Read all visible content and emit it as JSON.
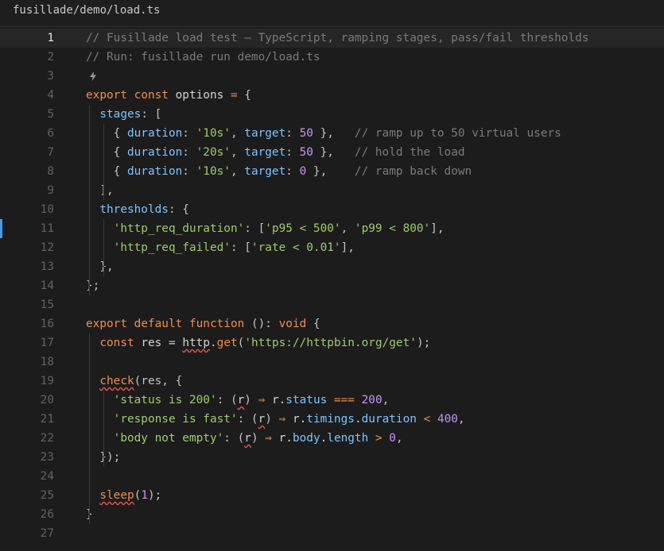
{
  "file_path": "fusillade/demo/load.ts",
  "active_line": 1,
  "modified_line": 11,
  "colors": {
    "background": "#1c1c1c",
    "keyword": "#f28d4d",
    "comment": "#7a7a7a",
    "string": "#9ecb6b",
    "number": "#c594f4",
    "property": "#7cc4ff",
    "modified_marker": "#4a9bd9"
  },
  "icons": [
    "lightbulb-icon"
  ],
  "lines": [
    {
      "n": "1",
      "tokens": [
        {
          "t": "// Fusillade load test — TypeScript, ramping stages, pass/fail thresholds",
          "c": "cm"
        }
      ]
    },
    {
      "n": "2",
      "tokens": [
        {
          "t": "// Run: fusillade run demo/load.ts",
          "c": "cm"
        }
      ]
    },
    {
      "n": "3",
      "tokens": []
    },
    {
      "n": "4",
      "tokens": [
        {
          "t": "export",
          "c": "kw"
        },
        {
          "t": " "
        },
        {
          "t": "const",
          "c": "kw"
        },
        {
          "t": " options "
        },
        {
          "t": "=",
          "c": "op"
        },
        {
          "t": " {",
          "c": "punc"
        }
      ]
    },
    {
      "n": "5",
      "tokens": [
        {
          "t": "  "
        },
        {
          "t": "stages",
          "c": "prop"
        },
        {
          "t": ": [",
          "c": "punc"
        }
      ]
    },
    {
      "n": "6",
      "tokens": [
        {
          "t": "    { ",
          "c": "punc"
        },
        {
          "t": "duration",
          "c": "prop"
        },
        {
          "t": ": ",
          "c": "punc"
        },
        {
          "t": "'10s'",
          "c": "str"
        },
        {
          "t": ", ",
          "c": "punc"
        },
        {
          "t": "target",
          "c": "prop"
        },
        {
          "t": ": ",
          "c": "punc"
        },
        {
          "t": "50",
          "c": "num"
        },
        {
          "t": " },   ",
          "c": "punc"
        },
        {
          "t": "// ramp up to 50 virtual users",
          "c": "cm"
        }
      ]
    },
    {
      "n": "7",
      "tokens": [
        {
          "t": "    { ",
          "c": "punc"
        },
        {
          "t": "duration",
          "c": "prop"
        },
        {
          "t": ": ",
          "c": "punc"
        },
        {
          "t": "'20s'",
          "c": "str"
        },
        {
          "t": ", ",
          "c": "punc"
        },
        {
          "t": "target",
          "c": "prop"
        },
        {
          "t": ": ",
          "c": "punc"
        },
        {
          "t": "50",
          "c": "num"
        },
        {
          "t": " },   ",
          "c": "punc"
        },
        {
          "t": "// hold the load",
          "c": "cm"
        }
      ]
    },
    {
      "n": "8",
      "tokens": [
        {
          "t": "    { ",
          "c": "punc"
        },
        {
          "t": "duration",
          "c": "prop"
        },
        {
          "t": ": ",
          "c": "punc"
        },
        {
          "t": "'10s'",
          "c": "str"
        },
        {
          "t": ", ",
          "c": "punc"
        },
        {
          "t": "target",
          "c": "prop"
        },
        {
          "t": ": ",
          "c": "punc"
        },
        {
          "t": "0",
          "c": "num"
        },
        {
          "t": " },    ",
          "c": "punc"
        },
        {
          "t": "// ramp back down",
          "c": "cm"
        }
      ]
    },
    {
      "n": "9",
      "tokens": [
        {
          "t": "  ],",
          "c": "punc"
        }
      ]
    },
    {
      "n": "10",
      "tokens": [
        {
          "t": "  "
        },
        {
          "t": "thresholds",
          "c": "prop"
        },
        {
          "t": ": {",
          "c": "punc"
        }
      ]
    },
    {
      "n": "11",
      "tokens": [
        {
          "t": "    "
        },
        {
          "t": "'http_req_duration'",
          "c": "str"
        },
        {
          "t": ": [",
          "c": "punc"
        },
        {
          "t": "'p95 < 500'",
          "c": "str"
        },
        {
          "t": ", ",
          "c": "punc"
        },
        {
          "t": "'p99 < 800'",
          "c": "str"
        },
        {
          "t": "],",
          "c": "punc"
        }
      ]
    },
    {
      "n": "12",
      "tokens": [
        {
          "t": "    "
        },
        {
          "t": "'http_req_failed'",
          "c": "str"
        },
        {
          "t": ": [",
          "c": "punc"
        },
        {
          "t": "'rate < 0.01'",
          "c": "str"
        },
        {
          "t": "],",
          "c": "punc"
        }
      ]
    },
    {
      "n": "13",
      "tokens": [
        {
          "t": "  },",
          "c": "punc"
        }
      ]
    },
    {
      "n": "14",
      "tokens": [
        {
          "t": "};",
          "c": "punc"
        }
      ]
    },
    {
      "n": "15",
      "tokens": []
    },
    {
      "n": "16",
      "tokens": [
        {
          "t": "export",
          "c": "kw"
        },
        {
          "t": " "
        },
        {
          "t": "default",
          "c": "kw"
        },
        {
          "t": " "
        },
        {
          "t": "function",
          "c": "kw"
        },
        {
          "t": " (): ",
          "c": "punc"
        },
        {
          "t": "void",
          "c": "kw"
        },
        {
          "t": " {",
          "c": "punc"
        }
      ]
    },
    {
      "n": "17",
      "tokens": [
        {
          "t": "  "
        },
        {
          "t": "const",
          "c": "kw"
        },
        {
          "t": " res "
        },
        {
          "t": "=",
          "c": "plain"
        },
        {
          "t": " "
        },
        {
          "t": "http",
          "c": "plain",
          "sq": true
        },
        {
          "t": ".",
          "c": "punc"
        },
        {
          "t": "get",
          "c": "kw"
        },
        {
          "t": "(",
          "c": "punc"
        },
        {
          "t": "'https://httpbin.org/get'",
          "c": "str"
        },
        {
          "t": ");",
          "c": "punc"
        }
      ]
    },
    {
      "n": "18",
      "tokens": []
    },
    {
      "n": "19",
      "tokens": [
        {
          "t": "  "
        },
        {
          "t": "check",
          "c": "kw",
          "sq": true
        },
        {
          "t": "(res, {",
          "c": "punc"
        }
      ]
    },
    {
      "n": "20",
      "tokens": [
        {
          "t": "    "
        },
        {
          "t": "'status is 200'",
          "c": "str"
        },
        {
          "t": ": (",
          "c": "punc"
        },
        {
          "t": "r",
          "c": "plain",
          "sq": true
        },
        {
          "t": ") ",
          "c": "punc"
        },
        {
          "t": "⇒",
          "c": "op"
        },
        {
          "t": " r."
        },
        {
          "t": "status",
          "c": "prop"
        },
        {
          "t": " "
        },
        {
          "t": "===",
          "c": "op"
        },
        {
          "t": " "
        },
        {
          "t": "200",
          "c": "num"
        },
        {
          "t": ",",
          "c": "punc"
        }
      ]
    },
    {
      "n": "21",
      "tokens": [
        {
          "t": "    "
        },
        {
          "t": "'response is fast'",
          "c": "str"
        },
        {
          "t": ": (",
          "c": "punc"
        },
        {
          "t": "r",
          "c": "plain",
          "sq": true
        },
        {
          "t": ") ",
          "c": "punc"
        },
        {
          "t": "⇒",
          "c": "op"
        },
        {
          "t": " r."
        },
        {
          "t": "timings",
          "c": "prop"
        },
        {
          "t": "."
        },
        {
          "t": "duration",
          "c": "prop"
        },
        {
          "t": " "
        },
        {
          "t": "<",
          "c": "op"
        },
        {
          "t": " "
        },
        {
          "t": "400",
          "c": "num"
        },
        {
          "t": ",",
          "c": "punc"
        }
      ]
    },
    {
      "n": "22",
      "tokens": [
        {
          "t": "    "
        },
        {
          "t": "'body not empty'",
          "c": "str"
        },
        {
          "t": ": (",
          "c": "punc"
        },
        {
          "t": "r",
          "c": "plain",
          "sq": true
        },
        {
          "t": ") ",
          "c": "punc"
        },
        {
          "t": "⇒",
          "c": "op"
        },
        {
          "t": " r."
        },
        {
          "t": "body",
          "c": "prop"
        },
        {
          "t": "."
        },
        {
          "t": "length",
          "c": "prop"
        },
        {
          "t": " "
        },
        {
          "t": ">",
          "c": "op"
        },
        {
          "t": " "
        },
        {
          "t": "0",
          "c": "num"
        },
        {
          "t": ",",
          "c": "punc"
        }
      ]
    },
    {
      "n": "23",
      "tokens": [
        {
          "t": "  });",
          "c": "punc"
        }
      ]
    },
    {
      "n": "24",
      "tokens": []
    },
    {
      "n": "25",
      "tokens": [
        {
          "t": "  "
        },
        {
          "t": "sleep",
          "c": "kw",
          "sq": true
        },
        {
          "t": "(",
          "c": "punc"
        },
        {
          "t": "1",
          "c": "num"
        },
        {
          "t": ");",
          "c": "punc"
        }
      ]
    },
    {
      "n": "26",
      "tokens": [
        {
          "t": "}",
          "c": "punc"
        }
      ]
    },
    {
      "n": "27",
      "tokens": []
    }
  ]
}
